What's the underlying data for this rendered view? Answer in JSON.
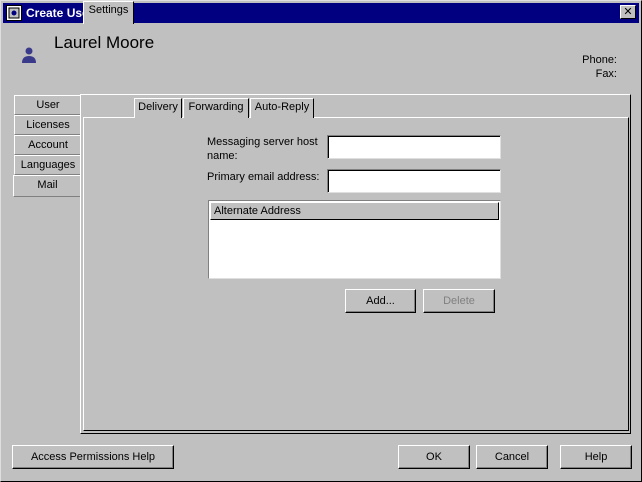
{
  "window": {
    "title": "Create User",
    "close_glyph": "✕"
  },
  "user": {
    "name": "Laurel Moore",
    "phone_label": "Phone:",
    "fax_label": "Fax:"
  },
  "left_tabs": [
    "User",
    "Licenses",
    "Account",
    "Languages",
    "Mail"
  ],
  "active_left_tab": "Mail",
  "mail_tabs": [
    "Settings",
    "Delivery",
    "Forwarding",
    "Auto-Reply"
  ],
  "active_mail_tab": "Settings",
  "settings": {
    "host_label_line1": "Messaging server host",
    "host_label_line2": "name:",
    "host_value": "",
    "email_label": "Primary email address:",
    "email_value": "",
    "alt_header": "Alternate Address",
    "add_button": "Add...",
    "delete_button": "Delete"
  },
  "footer": {
    "help_access": "Access Permissions Help",
    "ok": "OK",
    "cancel": "Cancel",
    "help": "Help"
  },
  "colors": {
    "titlebar": "#000080",
    "face": "#c0c0c0",
    "user_icon": "#3a3a8a"
  }
}
